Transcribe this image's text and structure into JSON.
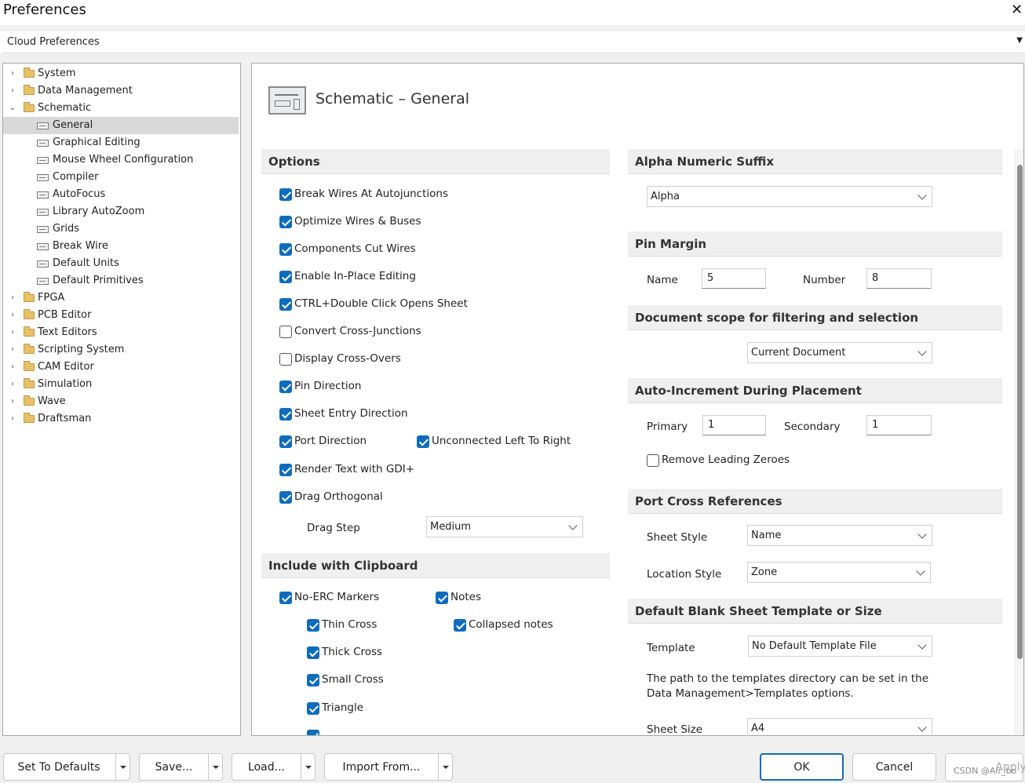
{
  "window": {
    "title": "Preferences",
    "close_label": "✕"
  },
  "cloud": {
    "value": "Cloud Preferences"
  },
  "tree": [
    {
      "label": "System",
      "expander": "›",
      "type": "folder"
    },
    {
      "label": "Data Management",
      "expander": "›",
      "type": "folder"
    },
    {
      "label": "Schematic",
      "expander": "⌄",
      "type": "folder"
    },
    {
      "label": "General",
      "type": "page",
      "selected": true
    },
    {
      "label": "Graphical Editing",
      "type": "page"
    },
    {
      "label": "Mouse Wheel Configuration",
      "type": "page"
    },
    {
      "label": "Compiler",
      "type": "page"
    },
    {
      "label": "AutoFocus",
      "type": "page"
    },
    {
      "label": "Library AutoZoom",
      "type": "page"
    },
    {
      "label": "Grids",
      "type": "page"
    },
    {
      "label": "Break Wire",
      "type": "page"
    },
    {
      "label": "Default Units",
      "type": "page"
    },
    {
      "label": "Default Primitives",
      "type": "page"
    },
    {
      "label": "FPGA",
      "expander": "›",
      "type": "folder"
    },
    {
      "label": "PCB Editor",
      "expander": "›",
      "type": "folder"
    },
    {
      "label": "Text Editors",
      "expander": "›",
      "type": "folder"
    },
    {
      "label": "Scripting System",
      "expander": "›",
      "type": "folder"
    },
    {
      "label": "CAM Editor",
      "expander": "›",
      "type": "folder"
    },
    {
      "label": "Simulation",
      "expander": "›",
      "type": "folder"
    },
    {
      "label": "Wave",
      "expander": "›",
      "type": "folder"
    },
    {
      "label": "Draftsman",
      "expander": "›",
      "type": "folder"
    }
  ],
  "page": {
    "title": "Schematic – General"
  },
  "options": {
    "header": "Options",
    "items": [
      {
        "label": "Break Wires At Autojunctions",
        "checked": true
      },
      {
        "label": "Optimize Wires & Buses",
        "checked": true
      },
      {
        "label": "Components Cut Wires",
        "checked": true
      },
      {
        "label": "Enable In-Place Editing",
        "checked": true
      },
      {
        "label": "CTRL+Double Click Opens Sheet",
        "checked": true
      },
      {
        "label": "Convert Cross-Junctions",
        "checked": false
      },
      {
        "label": "Display Cross-Overs",
        "checked": false
      },
      {
        "label": "Pin Direction",
        "checked": true
      },
      {
        "label": "Sheet Entry Direction",
        "checked": true
      },
      {
        "label": "Port Direction",
        "checked": true
      },
      {
        "label": "Unconnected Left To Right",
        "checked": true
      },
      {
        "label": "Render Text with GDI+",
        "checked": true
      },
      {
        "label": "Drag Orthogonal",
        "checked": true
      }
    ],
    "drag_step_label": "Drag Step",
    "drag_step_value": "Medium"
  },
  "clipboard": {
    "header": "Include with Clipboard",
    "items": [
      {
        "label": "No-ERC Markers",
        "checked": true
      },
      {
        "label": "Notes",
        "checked": true
      },
      {
        "label": "Thin Cross",
        "checked": true
      },
      {
        "label": "Collapsed notes",
        "checked": true
      },
      {
        "label": "Thick Cross",
        "checked": true
      },
      {
        "label": "Small Cross",
        "checked": true
      },
      {
        "label": "Triangle",
        "checked": true
      }
    ]
  },
  "alpha": {
    "header": "Alpha Numeric Suffix",
    "value": "Alpha"
  },
  "pin_margin": {
    "header": "Pin Margin",
    "name_label": "Name",
    "name_value": "5",
    "number_label": "Number",
    "number_value": "8"
  },
  "doc_scope": {
    "header": "Document scope for filtering and selection",
    "value": "Current Document"
  },
  "auto_inc": {
    "header": "Auto-Increment During Placement",
    "primary_label": "Primary",
    "primary_value": "1",
    "secondary_label": "Secondary",
    "secondary_value": "1",
    "remove_zeroes_label": "Remove Leading Zeroes",
    "remove_zeroes_checked": false
  },
  "port_cross": {
    "header": "Port Cross References",
    "sheet_style_label": "Sheet Style",
    "sheet_style_value": "Name",
    "location_style_label": "Location Style",
    "location_style_value": "Zone"
  },
  "template": {
    "header": "Default Blank Sheet Template or Size",
    "template_label": "Template",
    "template_value": "No Default Template File",
    "hint": "The path to the templates directory can be set in the Data Management>Templates options.",
    "sheet_size_label": "Sheet Size",
    "sheet_size_value": "A4"
  },
  "buttons": {
    "defaults": "Set To Defaults",
    "save": "Save...",
    "load": "Load...",
    "import": "Import From...",
    "ok": "OK",
    "cancel": "Cancel",
    "apply": "Apply"
  },
  "watermark": "CSDN @Air_bo"
}
